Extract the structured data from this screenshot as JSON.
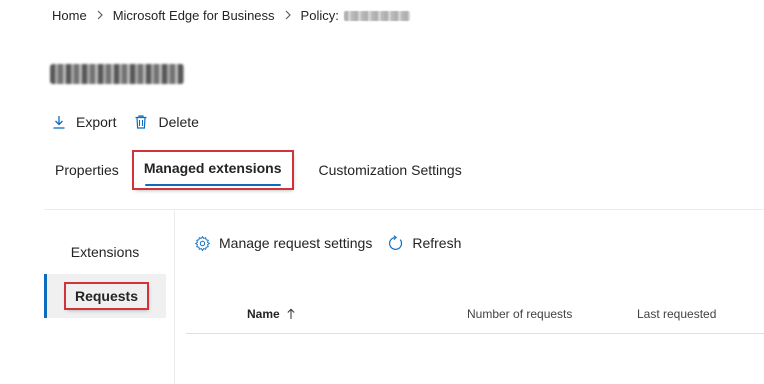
{
  "breadcrumb": {
    "home": "Home",
    "section": "Microsoft Edge for Business",
    "policy_prefix": "Policy:"
  },
  "commands": {
    "export": "Export",
    "delete": "Delete"
  },
  "tabs": [
    {
      "label": "Properties"
    },
    {
      "label": "Managed extensions"
    },
    {
      "label": "Customization Settings"
    }
  ],
  "left_nav": {
    "extensions": "Extensions",
    "requests": "Requests"
  },
  "toolbar": {
    "manage": "Manage request settings",
    "refresh": "Refresh"
  },
  "table": {
    "columns": [
      "Name",
      "Number of requests",
      "Last requested"
    ]
  },
  "colors": {
    "accent": "#0f6cbd",
    "highlight_box": "#d13438"
  },
  "icons": {
    "export": "download-arrow-icon",
    "delete": "trash-icon",
    "manage": "gear-icon",
    "refresh": "refresh-icon",
    "sort": "sort-ascending-icon"
  }
}
